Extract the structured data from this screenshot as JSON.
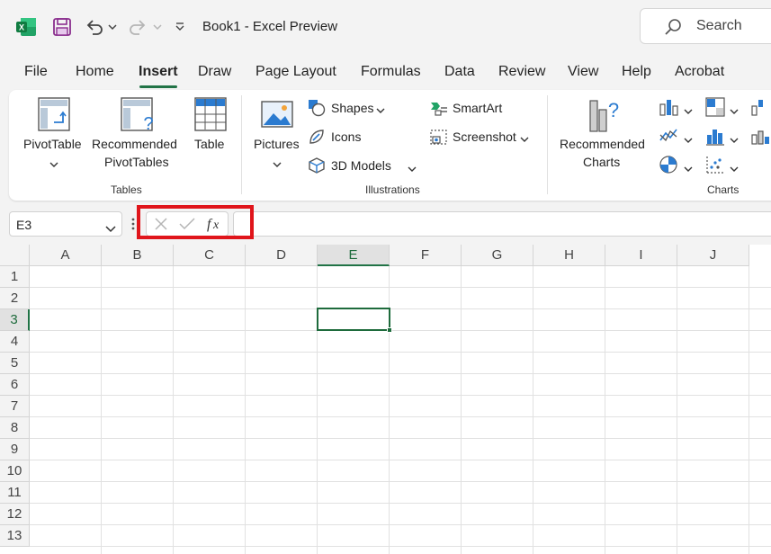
{
  "titlebar": {
    "title": "Book1  -  Excel Preview",
    "search_label": "Search"
  },
  "tabs": [
    {
      "label": "File"
    },
    {
      "label": "Home"
    },
    {
      "label": "Insert",
      "active": true
    },
    {
      "label": "Draw"
    },
    {
      "label": "Page Layout"
    },
    {
      "label": "Formulas"
    },
    {
      "label": "Data"
    },
    {
      "label": "Review"
    },
    {
      "label": "View"
    },
    {
      "label": "Help"
    },
    {
      "label": "Acrobat"
    }
  ],
  "ribbon": {
    "tables": {
      "group_name": "Tables",
      "pivottable": "PivotTable",
      "recommended_line1": "Recommended",
      "recommended_line2": "PivotTables",
      "table": "Table"
    },
    "illustrations": {
      "group_name": "Illustrations",
      "pictures": "Pictures",
      "shapes": "Shapes",
      "icons": "Icons",
      "models": "3D Models",
      "smartart": "SmartArt",
      "screenshot": "Screenshot"
    },
    "charts": {
      "group_name": "Charts",
      "recommended_line1": "Recommended",
      "recommended_line2": "Charts"
    }
  },
  "formula_bar": {
    "name_box": "E3",
    "formula_value": ""
  },
  "grid": {
    "columns": [
      "A",
      "B",
      "C",
      "D",
      "E",
      "F",
      "G",
      "H",
      "I",
      "J"
    ],
    "rows": [
      "1",
      "2",
      "3",
      "4",
      "5",
      "6",
      "7",
      "8",
      "9",
      "10",
      "11",
      "12",
      "13"
    ],
    "selected_cell": "E3"
  },
  "colors": {
    "accent": "#217346",
    "highlight": "#e0151b"
  }
}
